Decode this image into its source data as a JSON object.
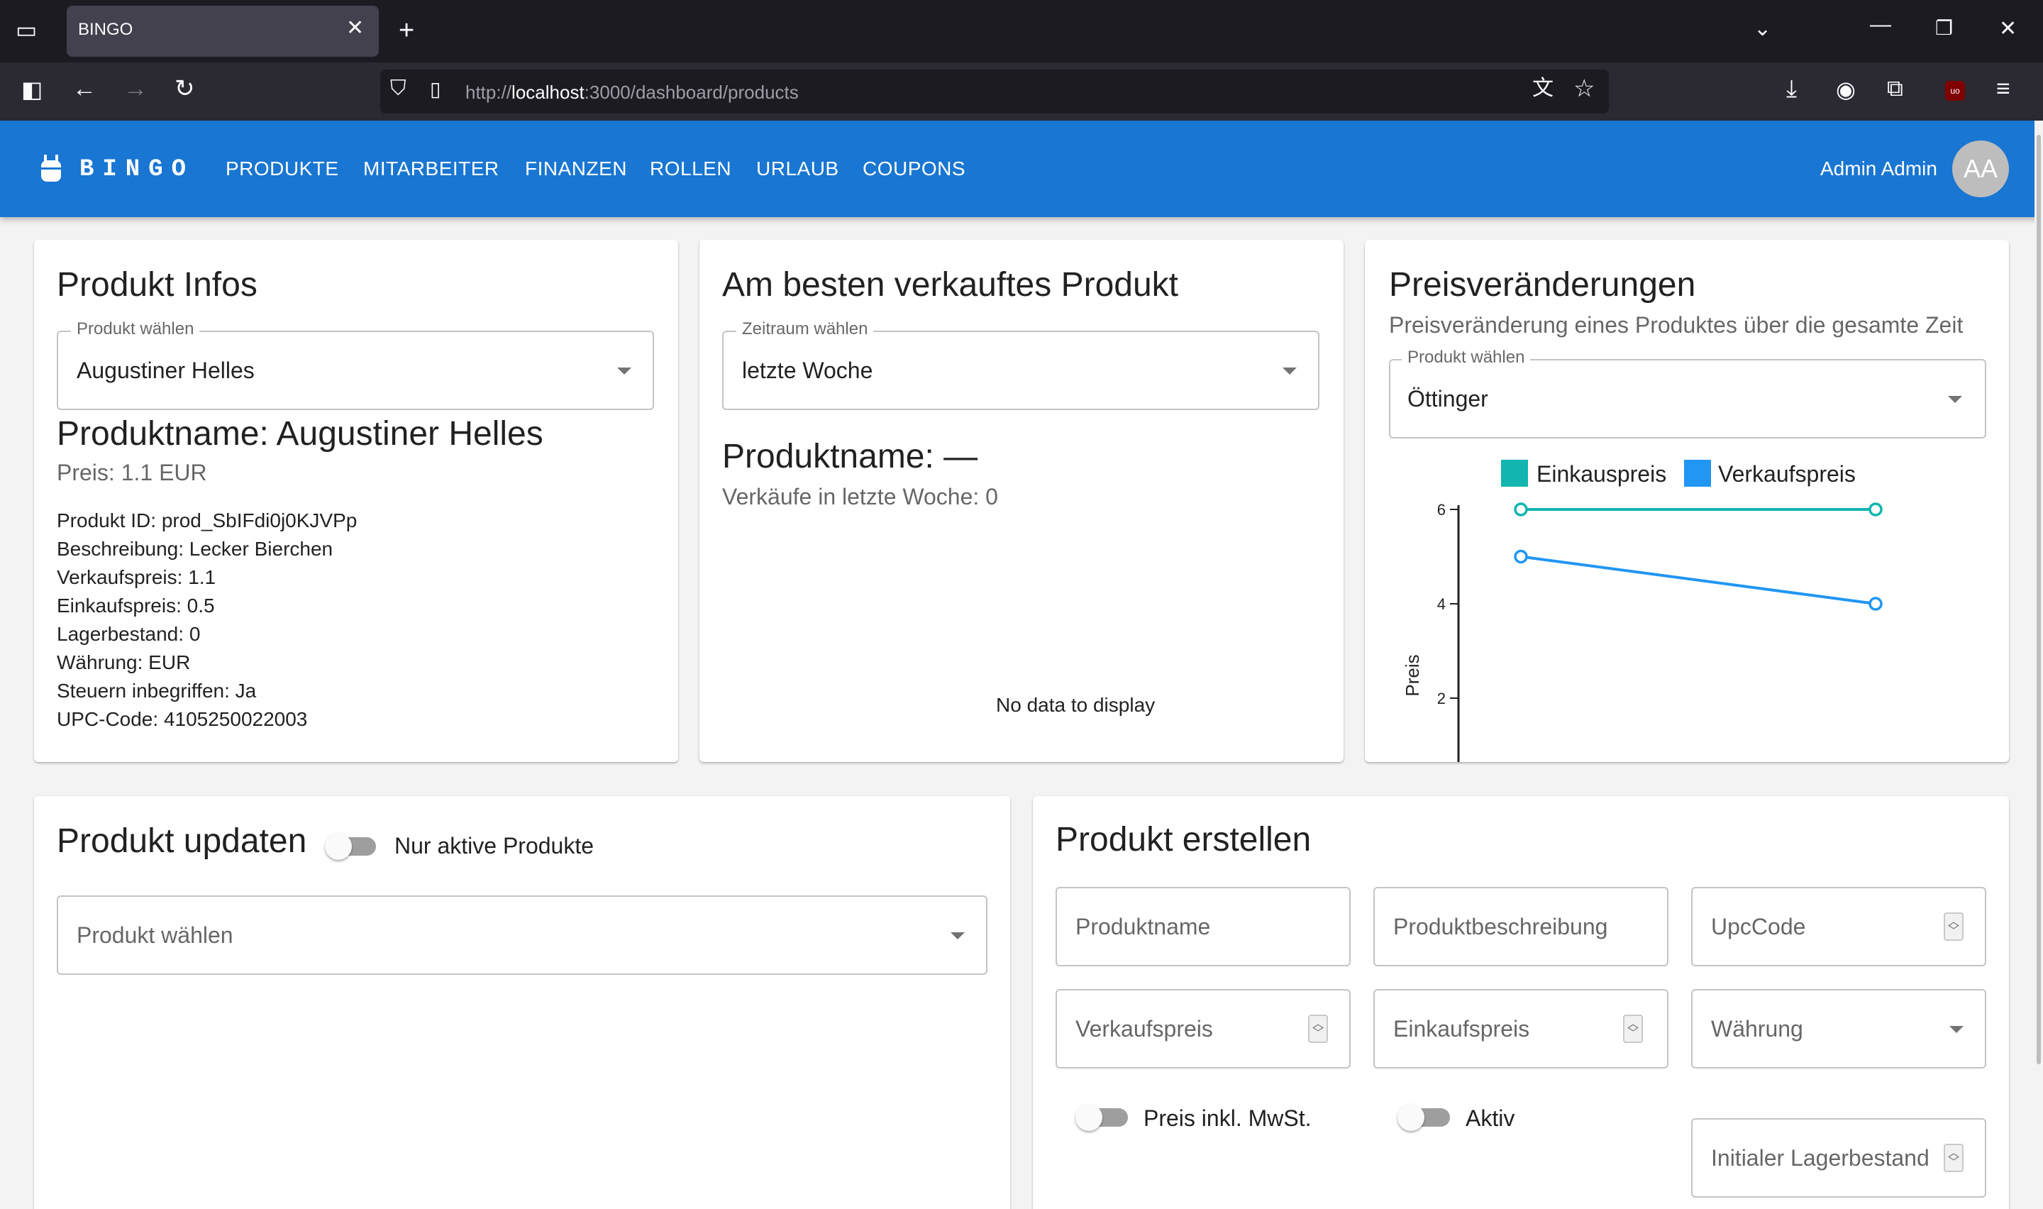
{
  "browser": {
    "tab_title": "BINGO",
    "url_prefix": "http://",
    "url_host": "localhost",
    "url_rest": ":3000/dashboard/products"
  },
  "appbar": {
    "brand": "BINGO",
    "nav": [
      "PRODUKTE",
      "MITARBEITER",
      "FINANZEN",
      "ROLLEN",
      "URLAUB",
      "COUPONS"
    ],
    "user_name": "Admin Admin",
    "avatar_initials": "AA",
    "color": "#1976d2"
  },
  "produkt_infos": {
    "title": "Produkt Infos",
    "select_label": "Produkt wählen",
    "select_value": "Augustiner Helles",
    "name_line": "Produktname: Augustiner Helles",
    "price_line": "Preis: 1.1 EUR",
    "details": [
      "Produkt ID: prod_SbIFdi0j0KJVPp",
      "Beschreibung: Lecker Bierchen",
      "Verkaufspreis: 1.1",
      "Einkaufspreis: 0.5",
      "Lagerbestand: 0",
      "Währung: EUR",
      "Steuern inbegriffen: Ja",
      "UPC-Code: 4105250022003"
    ]
  },
  "best_seller": {
    "title": "Am besten verkauftes Produkt",
    "select_label": "Zeitraum wählen",
    "select_value": "letzte Woche",
    "name_line": "Produktname: —",
    "sales_line": "Verkäufe in letzte Woche: 0",
    "empty_text": "No data to display"
  },
  "price_changes": {
    "title": "Preisveränderungen",
    "subtitle": "Preisveränderung eines Produktes über die gesamte Zeit",
    "select_label": "Produkt wählen",
    "select_value": "Öttinger"
  },
  "chart_data": {
    "type": "line",
    "ylabel": "Preis",
    "yticks": [
      2,
      4,
      6
    ],
    "ylim": [
      0.6,
      6.3
    ],
    "x": [
      0,
      1
    ],
    "series": [
      {
        "name": "Einkauspreis",
        "color": "#12b5b0",
        "values": [
          6,
          6
        ]
      },
      {
        "name": "Verkaufspreis",
        "color": "#2196f3",
        "values": [
          5,
          4
        ]
      }
    ],
    "legend": "top"
  },
  "produkt_updaten": {
    "title": "Produkt updaten",
    "toggle_label": "Nur aktive Produkte",
    "select_placeholder": "Produkt wählen"
  },
  "produkt_erstellen": {
    "title": "Produkt erstellen",
    "name_ph": "Produktname",
    "desc_ph": "Produktbeschreibung",
    "upc_ph": "UpcCode",
    "vk_ph": "Verkaufspreis",
    "ek_ph": "Einkaufspreis",
    "currency_ph": "Währung",
    "tax_toggle": "Preis inkl. MwSt.",
    "active_toggle": "Aktiv",
    "stock_ph": "Initialer Lagerbestand"
  }
}
